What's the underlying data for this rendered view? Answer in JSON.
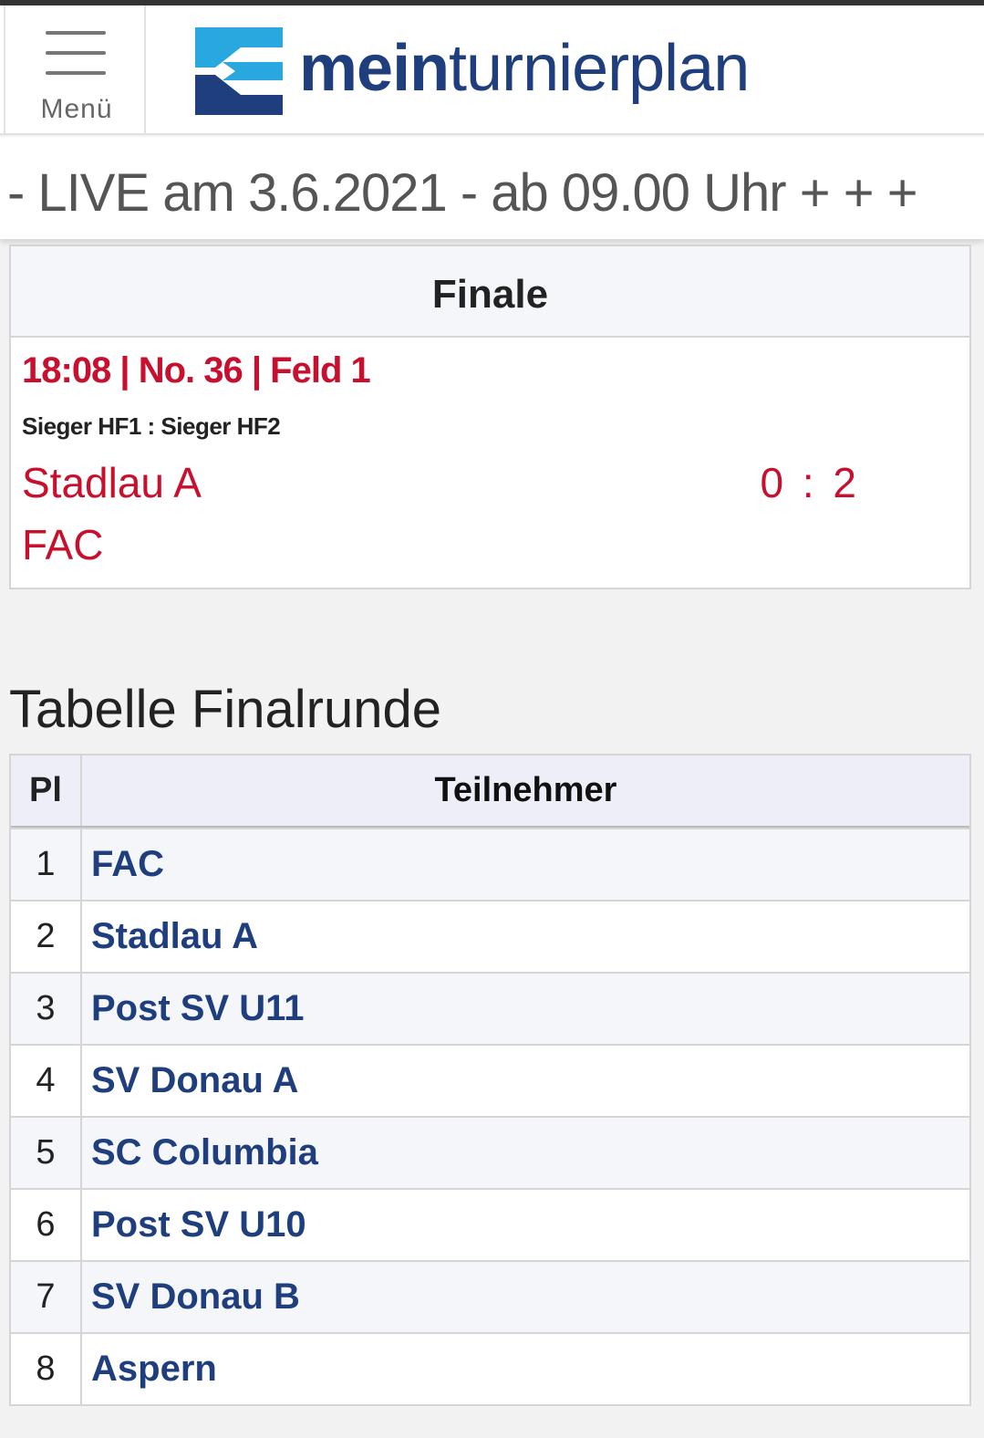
{
  "header": {
    "menu_label": "Menü",
    "logo_bold": "mein",
    "logo_rest": "turnierplan",
    "brand_colors": {
      "navy": "#1e3e7d",
      "cyan": "#29a8e0"
    }
  },
  "ticker": {
    "text": "- LIVE am 3.6.2021 - ab 09.00 Uhr + + +"
  },
  "match": {
    "round": "Finale",
    "info": "18:08 | No. 36 | Feld 1",
    "pairing": "Sieger HF1 : Sieger HF2",
    "team1": "Stadlau A",
    "team2": "FAC",
    "score": "0 : 2",
    "accent": "#c8102e"
  },
  "standings": {
    "title": "Tabelle Finalrunde",
    "col_place": "Pl",
    "col_team": "Teilnehmer",
    "rows": [
      {
        "place": "1",
        "team": "FAC"
      },
      {
        "place": "2",
        "team": "Stadlau A"
      },
      {
        "place": "3",
        "team": "Post SV U11"
      },
      {
        "place": "4",
        "team": "SV Donau A"
      },
      {
        "place": "5",
        "team": "SC Columbia"
      },
      {
        "place": "6",
        "team": "Post SV U10"
      },
      {
        "place": "7",
        "team": "SV Donau B"
      },
      {
        "place": "8",
        "team": "Aspern"
      }
    ]
  }
}
